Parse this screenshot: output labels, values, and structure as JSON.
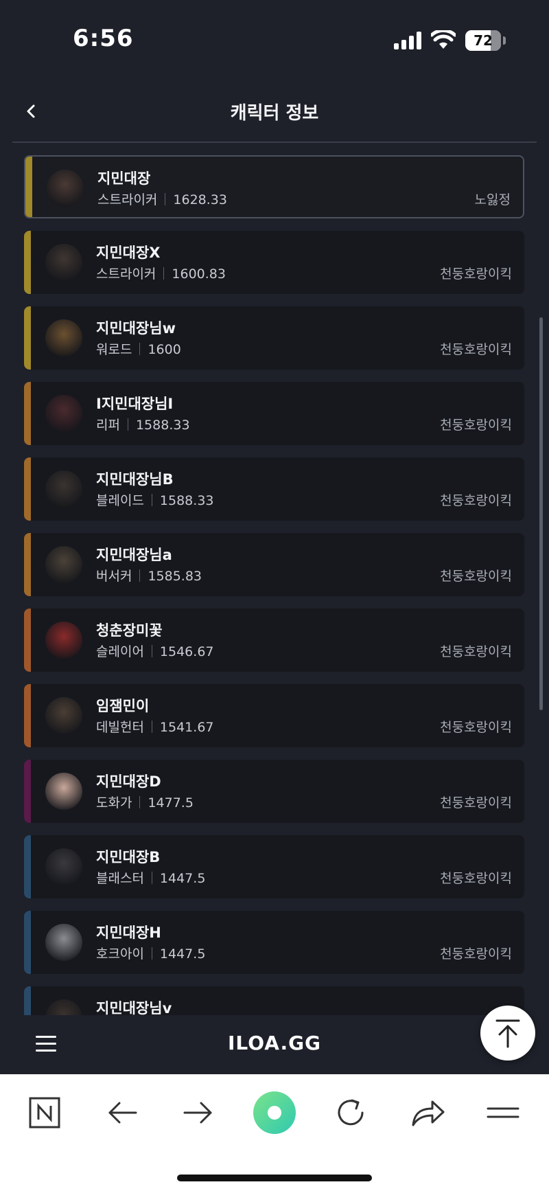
{
  "status_bar": {
    "time": "6:56",
    "battery": "72",
    "battery_level": 0.72
  },
  "header": {
    "title": "캐릭터 정보"
  },
  "characters": [
    {
      "name": "지민대장",
      "class": "스트라이커",
      "item_level": "1628.33",
      "server": "노잃정",
      "stripe": "#a08a2a",
      "avatar": "#4a3a34",
      "selected": true
    },
    {
      "name": "지민대장X",
      "class": "스트라이커",
      "item_level": "1600.83",
      "server": "천둥호랑이킥",
      "stripe": "#a08a2a",
      "avatar": "#3f3632",
      "selected": false
    },
    {
      "name": "지민대장님w",
      "class": "워로드",
      "item_level": "1600",
      "server": "천둥호랑이킥",
      "stripe": "#a08a2a",
      "avatar": "#6b5030",
      "selected": false
    },
    {
      "name": "I지민대장님I",
      "class": "리퍼",
      "item_level": "1588.33",
      "server": "천둥호랑이킥",
      "stripe": "#a06a2a",
      "avatar": "#4a2a2e",
      "selected": false
    },
    {
      "name": "지민대장님B",
      "class": "블레이드",
      "item_level": "1588.33",
      "server": "천둥호랑이킥",
      "stripe": "#a06a2a",
      "avatar": "#3a3430",
      "selected": false
    },
    {
      "name": "지민대장님a",
      "class": "버서커",
      "item_level": "1585.83",
      "server": "천둥호랑이킥",
      "stripe": "#a06a2a",
      "avatar": "#4a4238",
      "selected": false
    },
    {
      "name": "청춘장미꽃",
      "class": "슬레이어",
      "item_level": "1546.67",
      "server": "천둥호랑이킥",
      "stripe": "#a0582a",
      "avatar": "#8a2a2a",
      "selected": false
    },
    {
      "name": "임잼민이",
      "class": "데빌헌터",
      "item_level": "1541.67",
      "server": "천둥호랑이킥",
      "stripe": "#a0582a",
      "avatar": "#4a3e34",
      "selected": false
    },
    {
      "name": "지민대장D",
      "class": "도화가",
      "item_level": "1477.5",
      "server": "천둥호랑이킥",
      "stripe": "#5a1a4a",
      "avatar": "#c9a89a",
      "selected": false
    },
    {
      "name": "지민대장B",
      "class": "블래스터",
      "item_level": "1447.5",
      "server": "천둥호랑이킥",
      "stripe": "#2a4a6a",
      "avatar": "#3a3a3e",
      "selected": false
    },
    {
      "name": "지민대장H",
      "class": "호크아이",
      "item_level": "1447.5",
      "server": "천둥호랑이킥",
      "stripe": "#2a4a6a",
      "avatar": "#8a8c90",
      "selected": false
    },
    {
      "name": "지민대장님v",
      "class": "",
      "item_level": "",
      "server": "",
      "stripe": "#2a4a6a",
      "avatar": "#3a322e",
      "selected": false
    }
  ],
  "site_bar": {
    "logo": "ILOA.GG"
  },
  "icons": {
    "back": "chevron-left-icon",
    "menu": "hamburger-menu-icon",
    "scroll_top": "arrow-up-to-top-icon",
    "browser_home": "naver-n-icon",
    "browser_back": "arrow-left-icon",
    "browser_forward": "arrow-right-icon",
    "browser_center": "green-circle-icon",
    "browser_reload": "reload-icon",
    "browser_share": "share-icon",
    "browser_menu": "menu-lines-icon"
  }
}
